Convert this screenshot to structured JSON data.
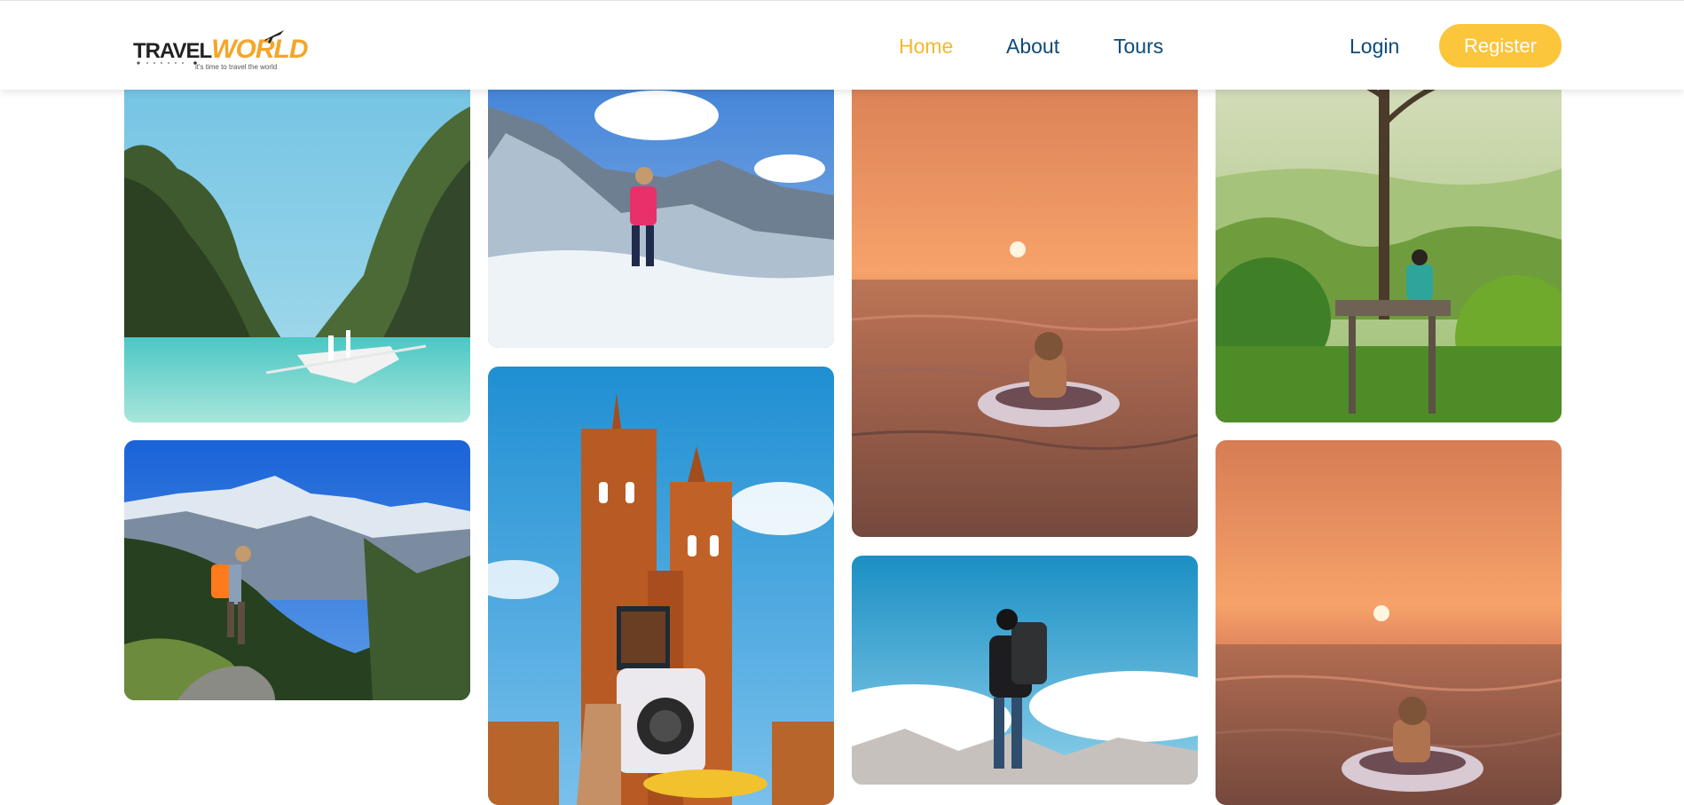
{
  "brand": {
    "name_part1": "TRAVEL",
    "name_part2": "WORLD",
    "tagline": "it's time to travel the world"
  },
  "nav": {
    "links": [
      {
        "label": "Home",
        "active": true
      },
      {
        "label": "About",
        "active": false
      },
      {
        "label": "Tours",
        "active": false
      }
    ],
    "login_label": "Login",
    "register_label": "Register"
  },
  "colors": {
    "accent": "#fbc53c",
    "nav_text": "#0b4a7a",
    "active_nav": "#f5b731"
  },
  "gallery": {
    "images": [
      {
        "name": "lagoon-boat-photo",
        "icon": "photo"
      },
      {
        "name": "mountain-climber-photo",
        "icon": "photo"
      },
      {
        "name": "sunset-float-photo",
        "icon": "photo"
      },
      {
        "name": "tree-platform-photo",
        "icon": "photo"
      },
      {
        "name": "hiker-mountains-photo",
        "icon": "photo"
      },
      {
        "name": "church-camera-photo",
        "icon": "photo"
      },
      {
        "name": "backpacker-clouds-photo",
        "icon": "photo"
      },
      {
        "name": "sunset-float-photo-2",
        "icon": "photo"
      }
    ]
  }
}
